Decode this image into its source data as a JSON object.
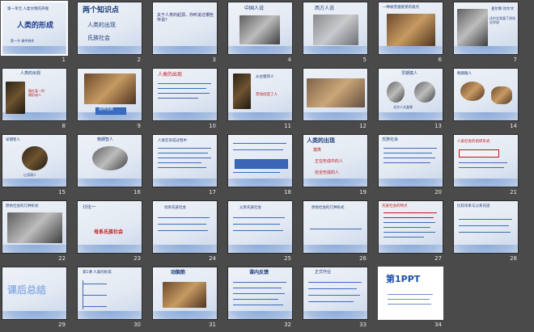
{
  "slides": [
    {
      "n": "1",
      "title": "人类的形成",
      "sub": "第一单元 人类文明的开端",
      "foot": "第一节 课件制作"
    },
    {
      "n": "2",
      "title": "两个知识点",
      "items": [
        "人类的出现",
        "氏族社会"
      ]
    },
    {
      "n": "3",
      "text": "关于人类的起源，你听说过哪些传说?"
    },
    {
      "n": "4",
      "text": "中国人说"
    },
    {
      "n": "5",
      "text": "西方人说"
    },
    {
      "n": "6",
      "text": "一种被普遍接受的观点"
    },
    {
      "n": "7",
      "text": "查尔斯·达尔文",
      "body": "达尔文发展了进化论学说"
    },
    {
      "n": "8",
      "text": "人类的出现",
      "hl": "猿在某一时期形成人"
    },
    {
      "n": "9",
      "text": "",
      "caption": "森林古猿"
    },
    {
      "n": "10",
      "text": "人类的出现"
    },
    {
      "n": "11",
      "text": "从古猿到人",
      "q": "劳动创造了人"
    },
    {
      "n": "12",
      "text": "早期猿人",
      "caption": "北京人头盖骨"
    },
    {
      "n": "13",
      "text": "晚期猿人"
    },
    {
      "n": "14",
      "text": "早期智人"
    },
    {
      "n": "15",
      "text": "晚期智人",
      "caption": "山顶洞人"
    },
    {
      "n": "16",
      "text": "晚期智人"
    },
    {
      "n": "17",
      "text": "人类在形成过程中"
    },
    {
      "n": "18",
      "text": "人类的出现",
      "items": [
        "猿类",
        "正在形成中的人",
        "完全形成的人"
      ]
    },
    {
      "n": "19",
      "text": "氏族社会"
    },
    {
      "n": "20",
      "text": "人类社会的组织形式"
    },
    {
      "n": "21",
      "text": "原始社会的几种形式"
    },
    {
      "n": "22",
      "text": "讨论一",
      "q": "母系氏族社会"
    },
    {
      "n": "23",
      "text": "母系氏族社会"
    },
    {
      "n": "24",
      "text": "父系氏族社会"
    },
    {
      "n": "25",
      "text": "原始社会的几种形式"
    },
    {
      "n": "26",
      "text": "氏族社会的特点"
    },
    {
      "n": "27",
      "text": "比较母系与父系氏族"
    },
    {
      "n": "28",
      "text": "课后总结"
    },
    {
      "n": "29",
      "text": "第1课 人类的形成"
    },
    {
      "n": "30",
      "text": "动脑筋"
    },
    {
      "n": "31",
      "text": "课内反馈"
    },
    {
      "n": "32",
      "text": "正式作业"
    },
    {
      "n": "33",
      "text": "第1PPT"
    },
    {
      "n": "34",
      "text": ""
    }
  ],
  "colors": {
    "accent": "#1d3c7a",
    "red": "#c01818",
    "bg": "#4a4a4a"
  }
}
